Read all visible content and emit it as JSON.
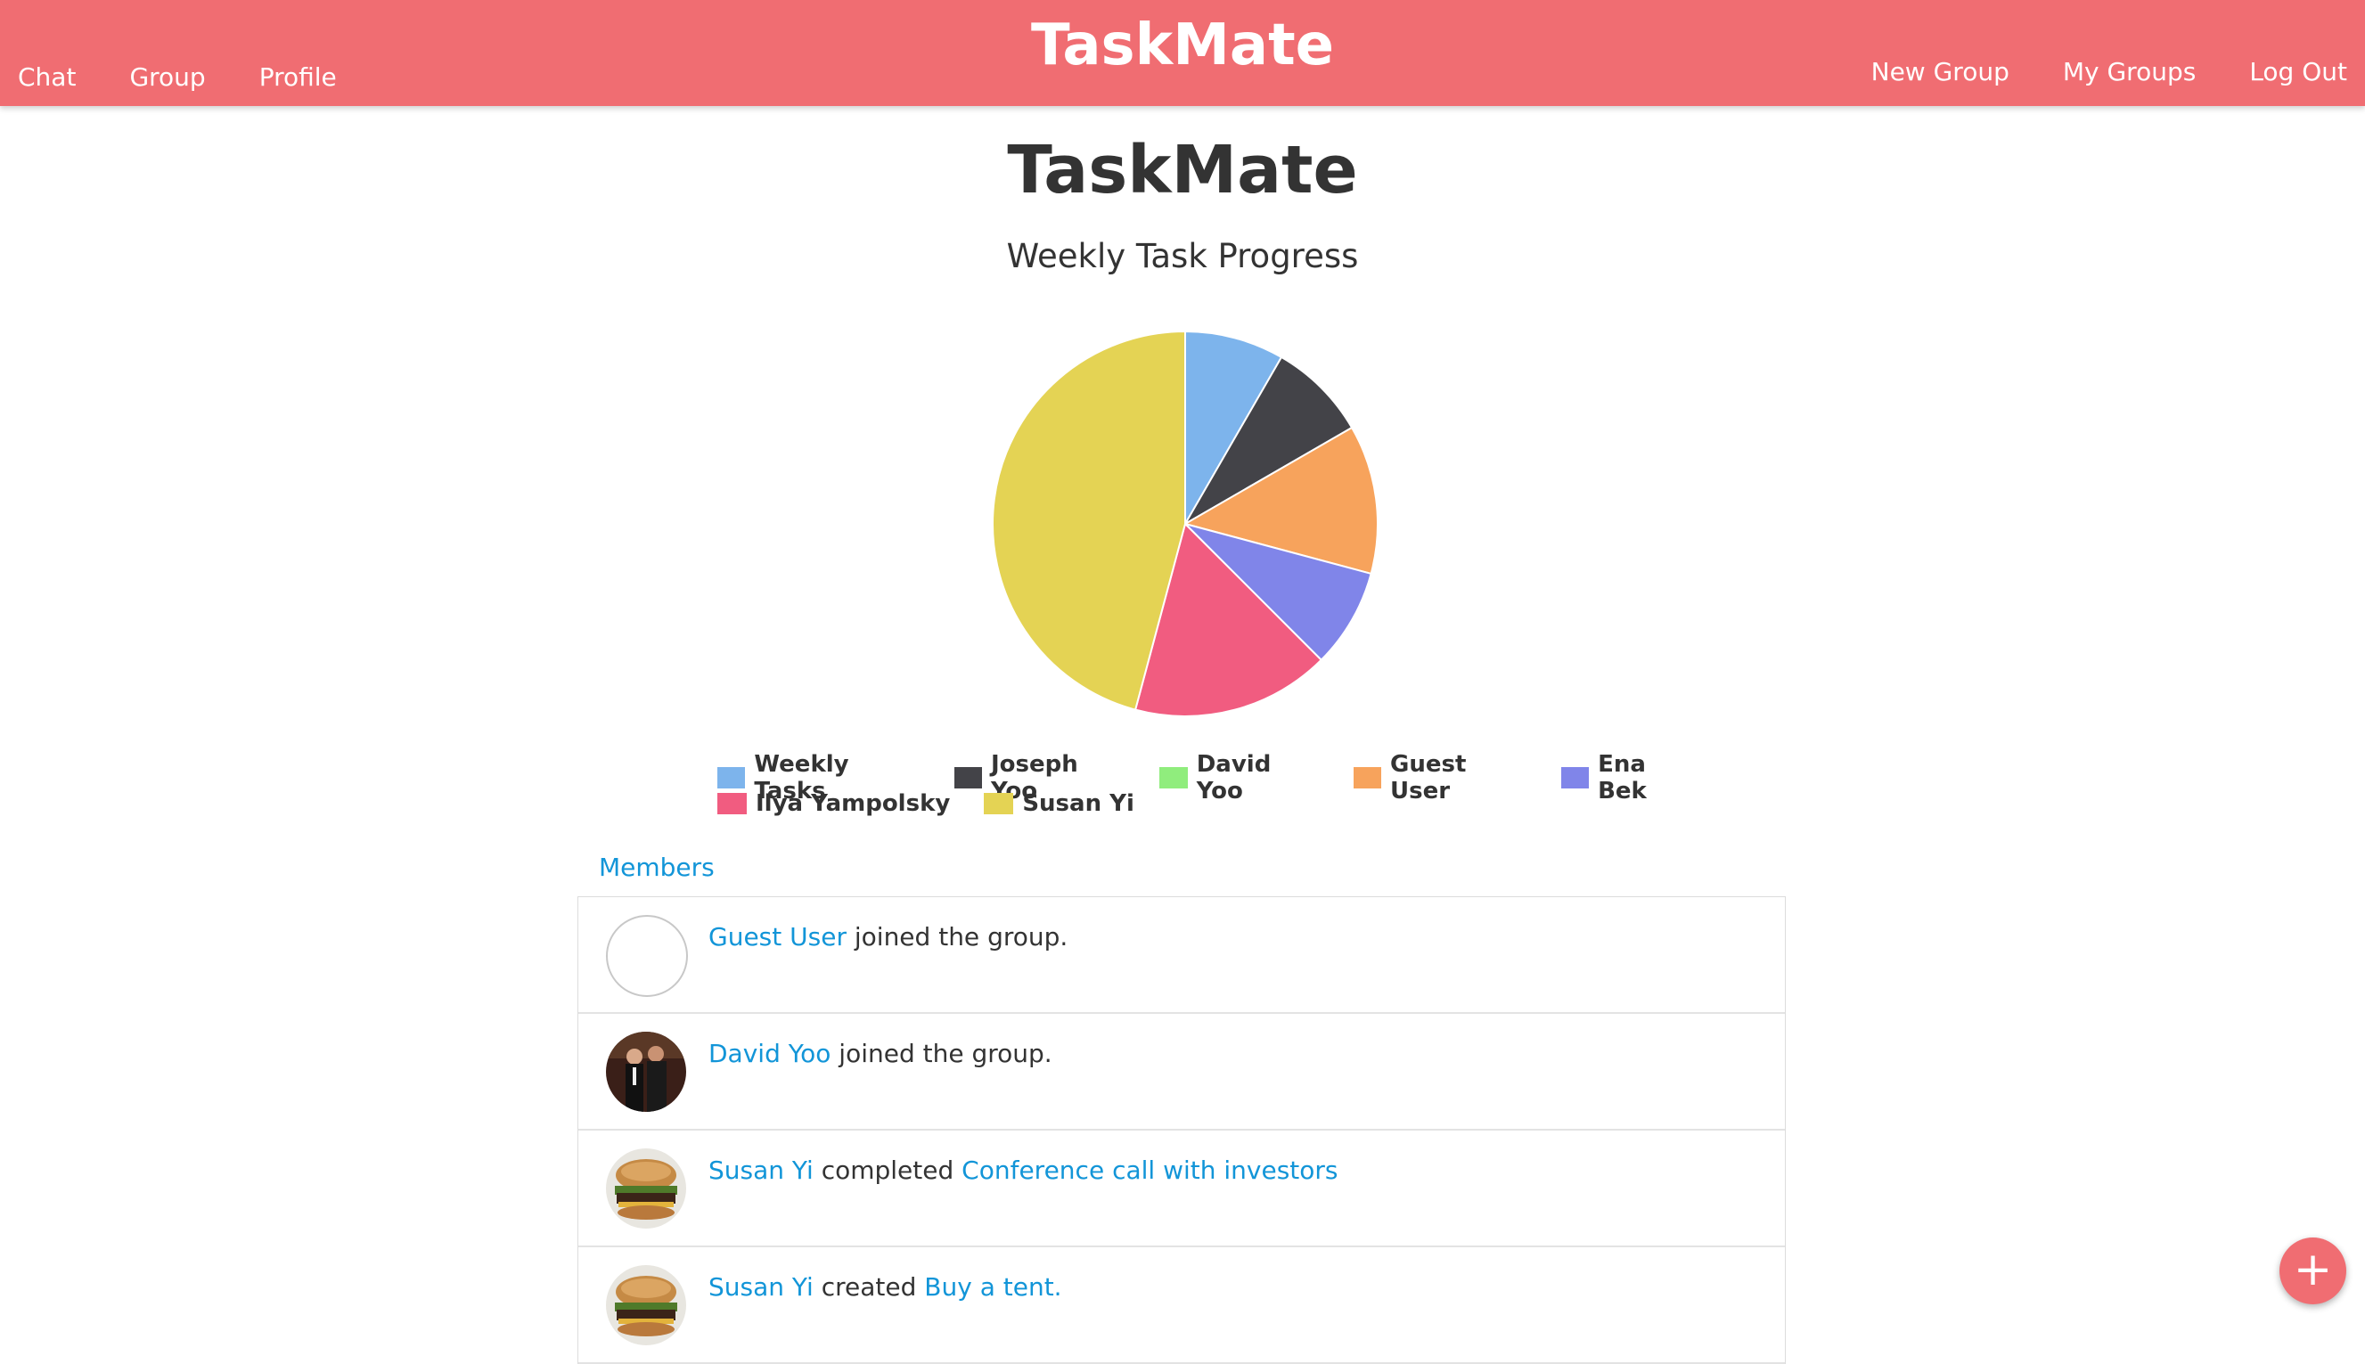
{
  "navbar": {
    "brand": "TaskMate",
    "left_links": [
      "Chat",
      "Group",
      "Profile"
    ],
    "right_links": [
      "New Group",
      "My Groups",
      "Log Out"
    ],
    "color": "#f06d72"
  },
  "page": {
    "title": "TaskMate"
  },
  "chart_data": {
    "type": "pie",
    "title": "Weekly Task Progress",
    "legend_position": "bottom",
    "series": [
      {
        "name": "Weekly Tasks",
        "value": 1,
        "color": "#7db4ec"
      },
      {
        "name": "Joseph Yoo",
        "value": 1,
        "color": "#434348"
      },
      {
        "name": "David Yoo",
        "value": 0,
        "color": "#90ed7d"
      },
      {
        "name": "Guest User",
        "value": 1.5,
        "color": "#f7a35c"
      },
      {
        "name": "Ena Bek",
        "value": 1,
        "color": "#8085e9"
      },
      {
        "name": "Ilya Yampolsky",
        "value": 2,
        "color": "#f15c80"
      },
      {
        "name": "Susan Yi",
        "value": 5.5,
        "color": "#e4d354"
      }
    ]
  },
  "tabs": {
    "members": "Members"
  },
  "feed": [
    {
      "actor": "Guest User",
      "action": "joined the group.",
      "target": "",
      "avatar": "empty-avatar"
    },
    {
      "actor": "David Yoo",
      "action": "joined the group.",
      "target": "",
      "avatar": "photo-avatar"
    },
    {
      "actor": "Susan Yi",
      "action": "completed",
      "target": "Conference call with investors",
      "avatar": "burger-avatar"
    },
    {
      "actor": "Susan Yi",
      "action": "created",
      "target": "Buy a tent.",
      "avatar": "burger-avatar"
    }
  ],
  "fab": {
    "label": "+",
    "icon": "plus-icon"
  }
}
